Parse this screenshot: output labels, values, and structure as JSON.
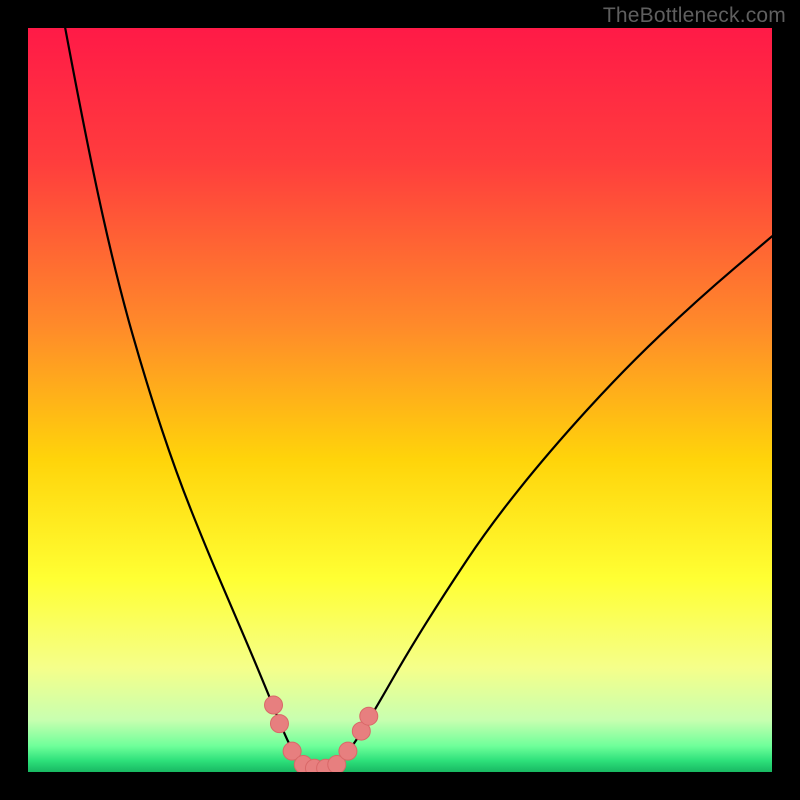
{
  "watermark": "TheBottleneck.com",
  "chart_data": {
    "type": "line",
    "title": "",
    "xlabel": "",
    "ylabel": "",
    "xlim": [
      0,
      100
    ],
    "ylim": [
      0,
      100
    ],
    "grid": false,
    "legend": false,
    "background_gradient_stops": [
      {
        "offset": 0.0,
        "color": "#ff1a47"
      },
      {
        "offset": 0.18,
        "color": "#ff3d3d"
      },
      {
        "offset": 0.4,
        "color": "#ff8a2a"
      },
      {
        "offset": 0.58,
        "color": "#ffd40a"
      },
      {
        "offset": 0.74,
        "color": "#ffff33"
      },
      {
        "offset": 0.86,
        "color": "#f5ff8a"
      },
      {
        "offset": 0.93,
        "color": "#c8ffb0"
      },
      {
        "offset": 0.965,
        "color": "#6fff9a"
      },
      {
        "offset": 0.985,
        "color": "#2de07a"
      },
      {
        "offset": 1.0,
        "color": "#18b862"
      }
    ],
    "series": [
      {
        "name": "bottleneck-curve",
        "stroke": "#000000",
        "stroke_width": 2.2,
        "points": [
          {
            "x": 5.0,
            "y": 100.0
          },
          {
            "x": 8.0,
            "y": 84.0
          },
          {
            "x": 12.0,
            "y": 66.0
          },
          {
            "x": 16.0,
            "y": 52.0
          },
          {
            "x": 20.0,
            "y": 40.0
          },
          {
            "x": 24.0,
            "y": 30.0
          },
          {
            "x": 27.0,
            "y": 23.0
          },
          {
            "x": 30.0,
            "y": 16.0
          },
          {
            "x": 32.5,
            "y": 10.0
          },
          {
            "x": 34.5,
            "y": 5.0
          },
          {
            "x": 36.0,
            "y": 2.0
          },
          {
            "x": 38.0,
            "y": 0.5
          },
          {
            "x": 40.0,
            "y": 0.5
          },
          {
            "x": 42.0,
            "y": 1.5
          },
          {
            "x": 44.0,
            "y": 4.0
          },
          {
            "x": 47.0,
            "y": 9.0
          },
          {
            "x": 51.0,
            "y": 16.0
          },
          {
            "x": 56.0,
            "y": 24.0
          },
          {
            "x": 62.0,
            "y": 33.0
          },
          {
            "x": 70.0,
            "y": 43.0
          },
          {
            "x": 80.0,
            "y": 54.0
          },
          {
            "x": 90.0,
            "y": 63.5
          },
          {
            "x": 100.0,
            "y": 72.0
          }
        ]
      }
    ],
    "markers": {
      "name": "highlight-dots",
      "fill": "#e77f7f",
      "stroke": "#d96868",
      "radius_px": 9,
      "points": [
        {
          "x": 33.0,
          "y": 9.0
        },
        {
          "x": 33.8,
          "y": 6.5
        },
        {
          "x": 35.5,
          "y": 2.8
        },
        {
          "x": 37.0,
          "y": 1.0
        },
        {
          "x": 38.5,
          "y": 0.5
        },
        {
          "x": 40.0,
          "y": 0.5
        },
        {
          "x": 41.5,
          "y": 1.0
        },
        {
          "x": 43.0,
          "y": 2.8
        },
        {
          "x": 44.8,
          "y": 5.5
        },
        {
          "x": 45.8,
          "y": 7.5
        }
      ]
    }
  }
}
